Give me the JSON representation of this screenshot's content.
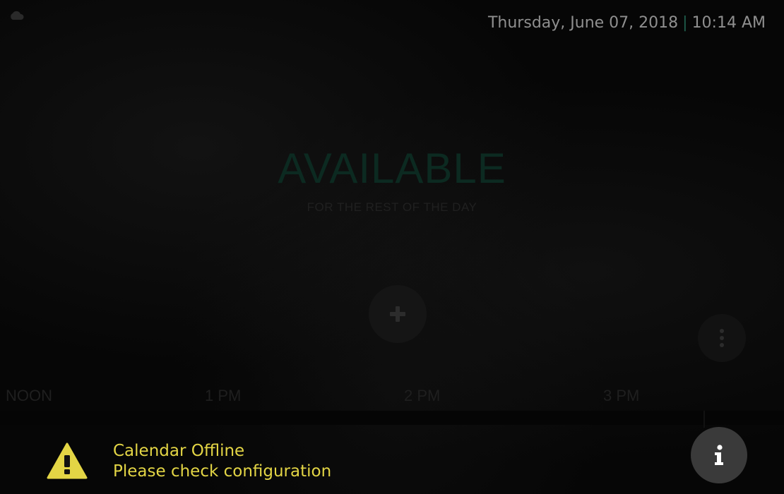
{
  "header": {
    "date": "Thursday, June 07, 2018",
    "separator": "|",
    "time": "10:14 AM",
    "status_icon": "cloud-icon"
  },
  "status": {
    "title": "AVAILABLE",
    "subtitle": "FOR THE REST OF THE DAY",
    "title_color": "#0c2a21"
  },
  "actions": {
    "add_icon": "plus-icon",
    "more_icon": "vertical-dots-icon",
    "info_icon": "info-icon"
  },
  "timeline": {
    "labels": [
      "NOON",
      "1 PM",
      "2 PM",
      "3 PM"
    ]
  },
  "alert": {
    "icon": "warning-icon",
    "line1": "Calendar Offline",
    "line2": "Please check configuration",
    "color": "#e3d545"
  }
}
